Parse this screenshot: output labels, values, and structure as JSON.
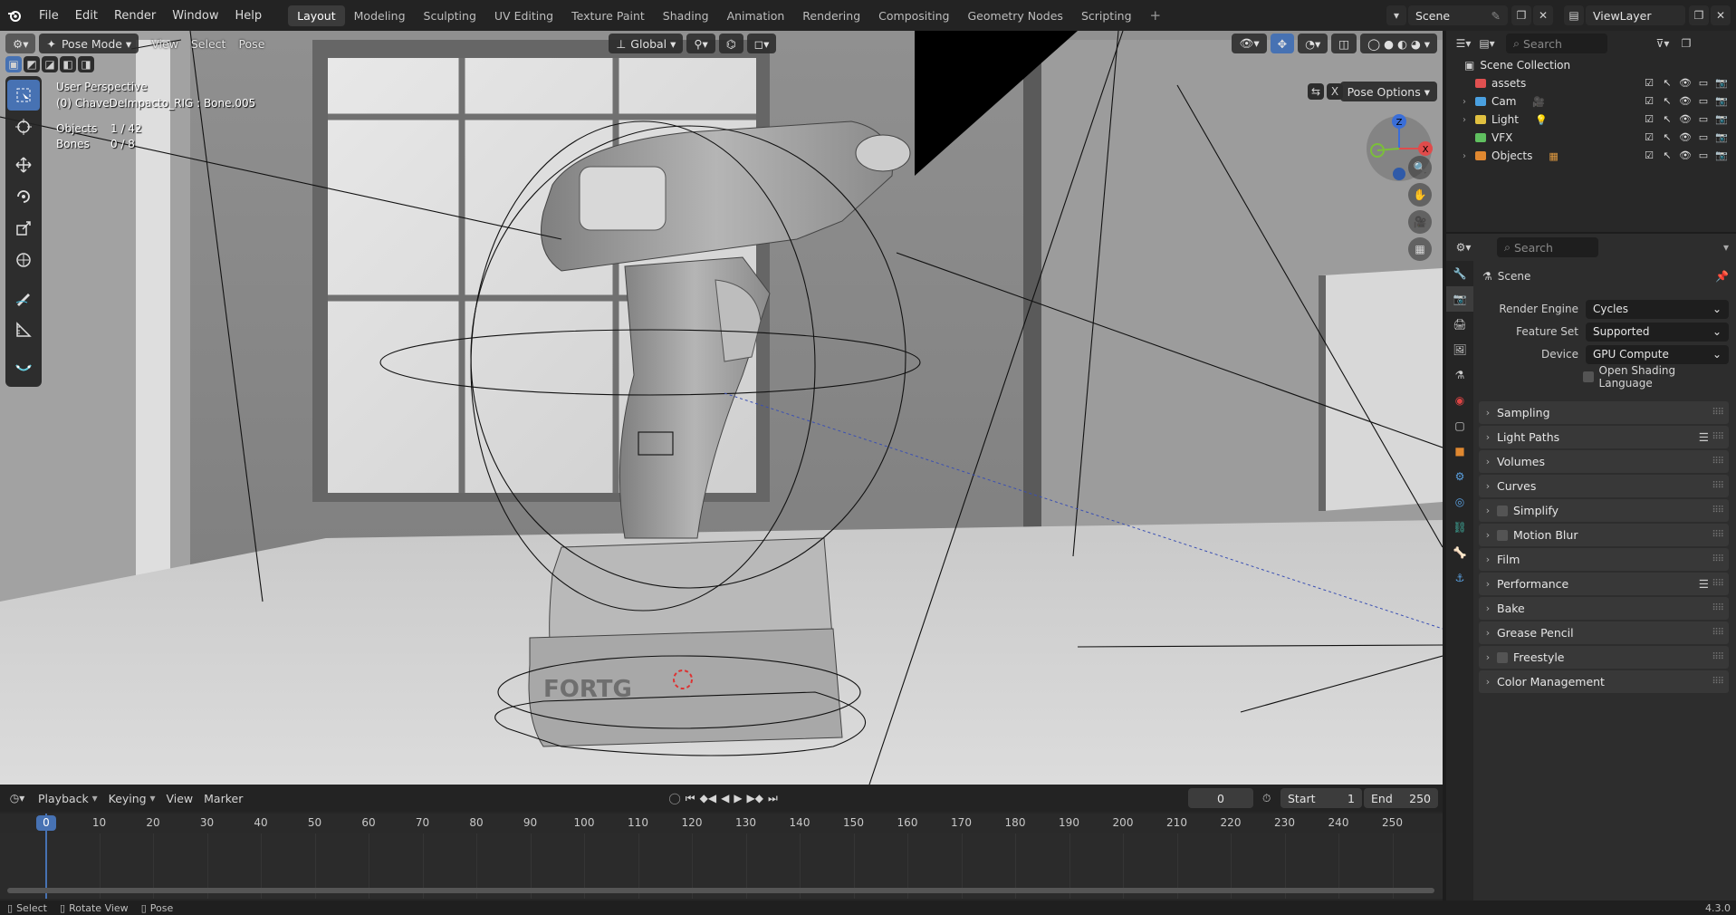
{
  "topbar": {
    "menus": [
      "File",
      "Edit",
      "Render",
      "Window",
      "Help"
    ],
    "workspaces": [
      "Layout",
      "Modeling",
      "Sculpting",
      "UV Editing",
      "Texture Paint",
      "Shading",
      "Animation",
      "Rendering",
      "Compositing",
      "Geometry Nodes",
      "Scripting"
    ],
    "active_workspace": "Layout",
    "scene": "Scene",
    "view_layer": "ViewLayer"
  },
  "viewport": {
    "mode": "Pose Mode",
    "menus": [
      "View",
      "Select",
      "Pose"
    ],
    "orientation": "Global",
    "pose_options": "Pose Options",
    "perspective": "User Perspective",
    "active_object": "(0) ChaveDeImpacto_RIG : Bone.005",
    "stats": {
      "objects_label": "Objects",
      "objects_value": "1 / 42",
      "bones_label": "Bones",
      "bones_value": "0 / 8"
    },
    "gizmo_axes": {
      "z": "Z",
      "x": "X"
    },
    "accent": "#4772b3"
  },
  "timeline": {
    "menus": [
      "Playback",
      "Keying",
      "View",
      "Marker"
    ],
    "current_frame": "0",
    "start_label": "Start",
    "start": "1",
    "end_label": "End",
    "end": "250",
    "ticks": [
      "0",
      "10",
      "20",
      "30",
      "40",
      "50",
      "60",
      "70",
      "80",
      "90",
      "100",
      "110",
      "120",
      "130",
      "140",
      "150",
      "160",
      "170",
      "180",
      "190",
      "200",
      "210",
      "220",
      "230",
      "240",
      "250"
    ]
  },
  "outliner": {
    "search_placeholder": "Search",
    "root": "Scene Collection",
    "items": [
      {
        "name": "assets",
        "color": "#e05050"
      },
      {
        "name": "Cam",
        "color": "#4aa0e0"
      },
      {
        "name": "Light",
        "color": "#e0c040"
      },
      {
        "name": "VFX",
        "color": "#60c060"
      },
      {
        "name": "Objects",
        "color": "#e08830"
      }
    ]
  },
  "properties": {
    "search_placeholder": "Search",
    "context": "Scene",
    "render_engine_label": "Render Engine",
    "render_engine": "Cycles",
    "feature_set_label": "Feature Set",
    "feature_set": "Supported",
    "device_label": "Device",
    "device": "GPU Compute",
    "osl_label": "Open Shading Language",
    "panels": [
      "Sampling",
      "Light Paths",
      "Volumes",
      "Curves",
      "Simplify",
      "Motion Blur",
      "Film",
      "Performance",
      "Bake",
      "Grease Pencil",
      "Freestyle",
      "Color Management"
    ]
  },
  "statusbar": {
    "select": "Select",
    "rotate": "Rotate View",
    "pose": "Pose",
    "version": "4.3.0"
  }
}
